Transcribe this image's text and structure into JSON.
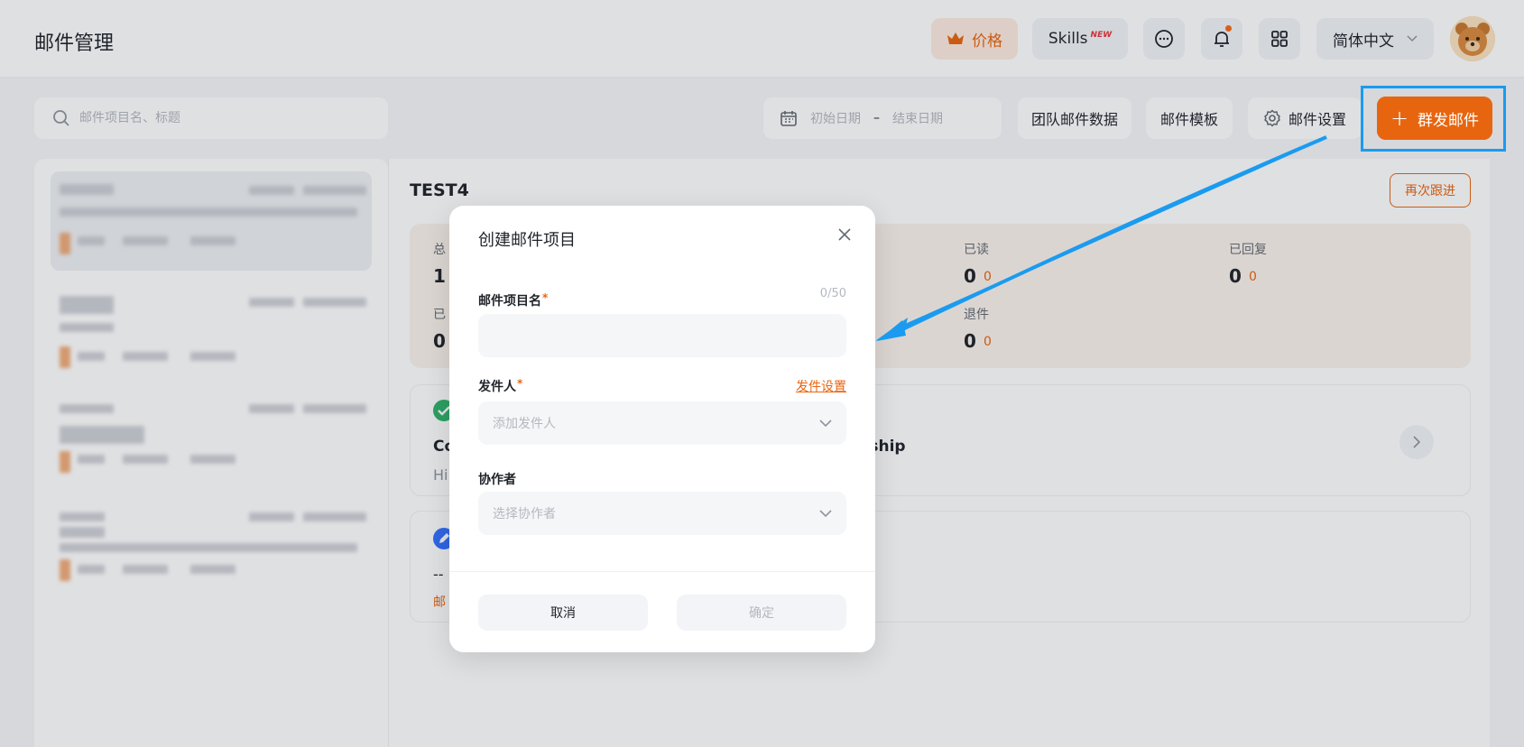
{
  "header": {
    "title": "邮件管理",
    "price_label": "价格",
    "skills_label": "Skills",
    "skills_badge": "NEW",
    "language_label": "简体中文"
  },
  "toolbar": {
    "search_placeholder": "邮件项目名、标题",
    "date_start_placeholder": "初始日期",
    "date_separator": "–",
    "date_end_placeholder": "结束日期",
    "team_data_label": "团队邮件数据",
    "template_label": "邮件模板",
    "settings_label": "邮件设置",
    "mass_mail_label": "群发邮件"
  },
  "project": {
    "title": "TEST4",
    "followup_label": "再次跟进",
    "stats": [
      {
        "label": "总",
        "value": "1",
        "sub": ""
      },
      {
        "label": "已读",
        "value": "0",
        "sub": "0"
      },
      {
        "label": "已回复",
        "value": "0",
        "sub": "0"
      },
      {
        "label": "已",
        "value": "0",
        "sub": ""
      },
      {
        "label": "退件",
        "value": "0",
        "sub": "0"
      }
    ]
  },
  "cards": [
    {
      "subject": "Co",
      "subject_tail": "rship",
      "preview": "Hi"
    },
    {
      "subject": "--",
      "tag": "邮"
    }
  ],
  "modal": {
    "title": "创建邮件项目",
    "name_label": "邮件项目名",
    "required_mark": "*",
    "counter": "0/50",
    "name_value": "",
    "sender_label": "发件人",
    "sender_settings_link": "发件设置",
    "sender_placeholder": "添加发件人",
    "collaborator_label": "协作者",
    "collaborator_placeholder": "选择协作者",
    "cancel_label": "取消",
    "confirm_label": "确定"
  },
  "colors": {
    "accent": "#e8650f",
    "annotation": "#1a9bf0"
  }
}
